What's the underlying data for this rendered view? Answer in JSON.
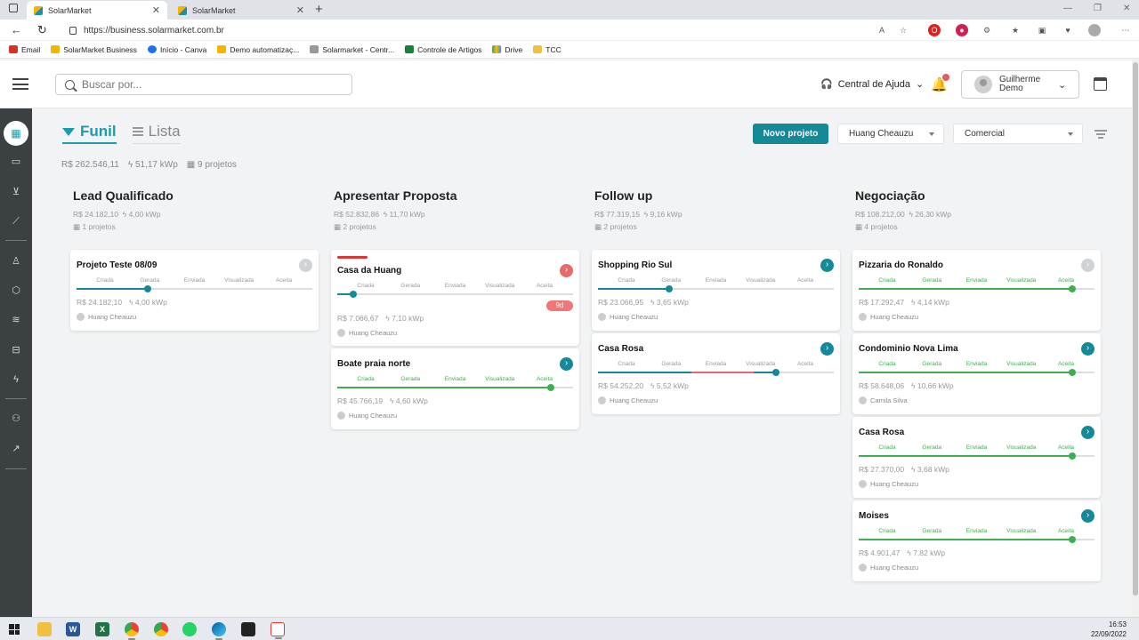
{
  "browser": {
    "tabs": [
      {
        "title": "SolarMarket"
      },
      {
        "title": "SolarMarket"
      }
    ],
    "url": "https://business.solarmarket.com.br",
    "bookmarks": [
      "Email",
      "SolarMarket Business",
      "Início - Canva",
      "Demo automatizaç...",
      "Solarmarket - Centr...",
      "Controle de Artigos",
      "Drive",
      "TCC"
    ]
  },
  "header": {
    "search_placeholder": "Buscar por...",
    "help_label": "Central de Ajuda",
    "user_name": "Guilherme Demo"
  },
  "view_tabs": {
    "funil": "Funil",
    "lista": "Lista"
  },
  "summary": {
    "value": "R$ 262.546,11",
    "power": "51,17 kWp",
    "projects": "9 projetos"
  },
  "toolbar": {
    "new_project": "Novo projeto",
    "owner_filter": "Huang Cheauzu",
    "pipeline_filter": "Comercial"
  },
  "stages": [
    "Criada",
    "Gerada",
    "Enviada",
    "Visualizada",
    "Aceita"
  ],
  "columns": [
    {
      "title": "Lead Qualificado",
      "value": "R$ 24.182,10",
      "power": "4,00 kWp",
      "projects": "1 projetos",
      "cards": [
        {
          "title": "Projeto Teste 08/09",
          "value": "R$ 24.182,10",
          "power": "4,00 kWp",
          "owner": "Huang Cheauzu",
          "stage": 1
        }
      ]
    },
    {
      "title": "Apresentar Proposta",
      "value": "R$ 52.832,86",
      "power": "11,70 kWp",
      "projects": "2 projetos",
      "cards": [
        {
          "title": "Casa da Huang",
          "value": "R$ 7.066,67",
          "power": "7,10 kWp",
          "owner": "Huang Cheauzu",
          "stage": 0,
          "badge": "9d"
        },
        {
          "title": "Boate praia norte",
          "value": "R$ 45.766,19",
          "power": "4,60 kWp",
          "owner": "Huang Cheauzu",
          "stage": 4
        }
      ]
    },
    {
      "title": "Follow up",
      "value": "R$ 77.319,15",
      "power": "9,16 kWp",
      "projects": "2 projetos",
      "cards": [
        {
          "title": "Shopping Rio Sul",
          "value": "R$ 23.066,95",
          "power": "3,65 kWp",
          "owner": "Huang Cheauzu",
          "stage": 1
        },
        {
          "title": "Casa Rosa",
          "value": "R$ 54.252,20",
          "power": "5,52 kWp",
          "owner": "Huang Cheauzu",
          "stage": 3
        }
      ]
    },
    {
      "title": "Negociação",
      "value": "R$ 108.212,00",
      "power": "26,30 kWp",
      "projects": "4 projetos",
      "cards": [
        {
          "title": "Pizzaria do Ronaldo",
          "value": "R$ 17.292,47",
          "power": "4,14 kWp",
          "owner": "Huang Cheauzu",
          "stage": 4
        },
        {
          "title": "Condominio Nova Lima",
          "value": "R$ 58.648,06",
          "power": "10,66 kWp",
          "owner": "Camila Silva",
          "stage": 4
        },
        {
          "title": "Casa Rosa",
          "value": "R$ 27.370,00",
          "power": "3,68 kWp",
          "owner": "Huang Cheauzu",
          "stage": 4
        },
        {
          "title": "Moises",
          "value": "R$ 4.901,47",
          "power": "7,82 kWp",
          "owner": "Huang Cheauzu",
          "stage": 4
        }
      ]
    }
  ],
  "taskbar": {
    "time": "16:53",
    "date": "22/09/2022"
  },
  "colors": {
    "accent": "#13899a",
    "won": "#3fae4f",
    "danger": "#e66a6a"
  }
}
